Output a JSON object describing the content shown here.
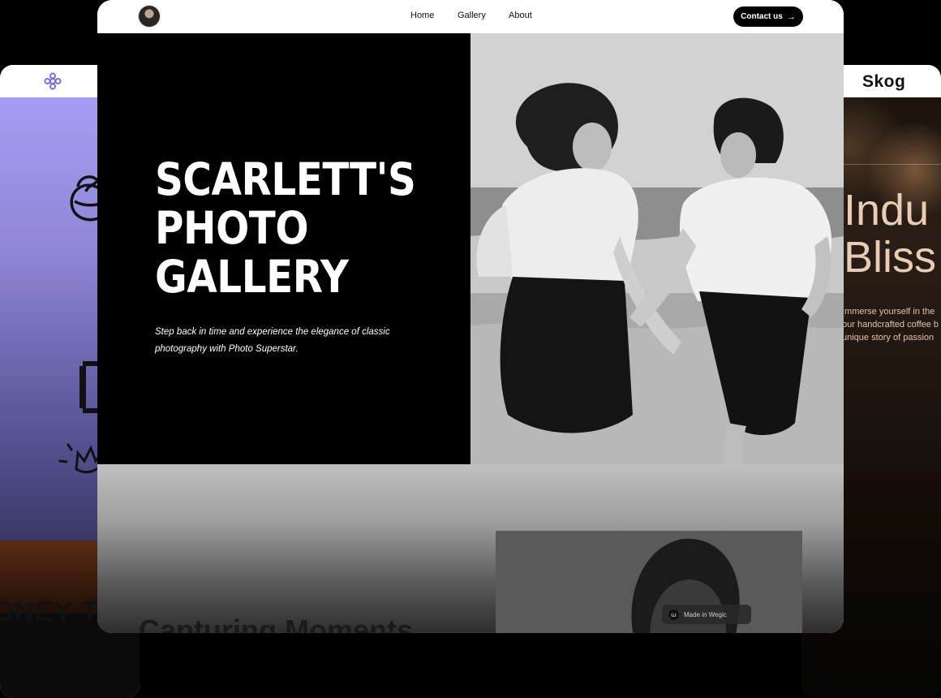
{
  "left_card": {
    "bottom_text": "ONEY T"
  },
  "right_card": {
    "brand": "Skog",
    "title_line1": "Indu",
    "title_line2": "Bliss",
    "text_line1": "Immerse yourself in the",
    "text_line2": "our handcrafted coffee b",
    "text_line3": "unique story of passion"
  },
  "nav": {
    "home": "Home",
    "gallery": "Gallery",
    "about": "About",
    "contact_label": "Contact us",
    "contact_arrow": "→"
  },
  "hero": {
    "title_line1": "SCARLETT'S",
    "title_line2": "PHOTO",
    "title_line3": "GALLERY",
    "subtitle": "Step back in time and experience the elegance of classic photography with Photo Superstar."
  },
  "section2": {
    "heading": "Capturing Moments"
  },
  "badge": {
    "label": "Made in Wegic",
    "icon_glyph": "ω"
  }
}
